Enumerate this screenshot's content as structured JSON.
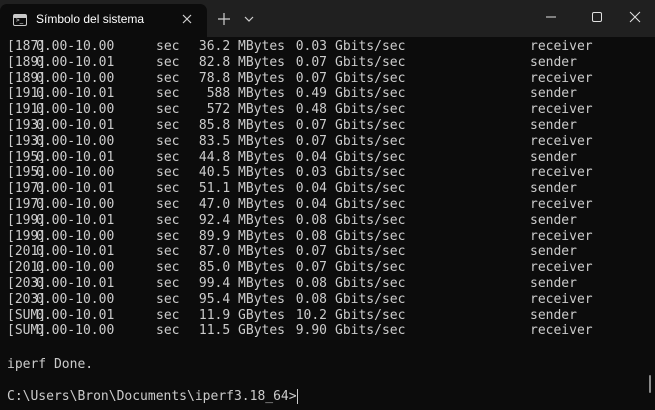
{
  "window": {
    "tab_title": "Símbolo del sistema",
    "icons": {
      "app": "cmd-icon",
      "tab_close": "close-icon",
      "new_tab": "plus-icon",
      "dropdown": "chevron-down-icon",
      "minimize": "minimize-icon",
      "maximize": "maximize-icon",
      "close": "close-icon"
    }
  },
  "terminal": {
    "rows": [
      {
        "id": "[187]",
        "interval": "0.00-10.00",
        "unit": "sec",
        "transfer": "36.2 MBytes",
        "rate": "0.03",
        "rate_unit": "Gbits/sec",
        "role": "receiver"
      },
      {
        "id": "[189]",
        "interval": "0.00-10.01",
        "unit": "sec",
        "transfer": "82.8 MBytes",
        "rate": "0.07",
        "rate_unit": "Gbits/sec",
        "role": "sender"
      },
      {
        "id": "[189]",
        "interval": "0.00-10.00",
        "unit": "sec",
        "transfer": "78.8 MBytes",
        "rate": "0.07",
        "rate_unit": "Gbits/sec",
        "role": "receiver"
      },
      {
        "id": "[191]",
        "interval": "0.00-10.01",
        "unit": "sec",
        "transfer": "588 MBytes",
        "rate": "0.49",
        "rate_unit": "Gbits/sec",
        "role": "sender"
      },
      {
        "id": "[191]",
        "interval": "0.00-10.00",
        "unit": "sec",
        "transfer": "572 MBytes",
        "rate": "0.48",
        "rate_unit": "Gbits/sec",
        "role": "receiver"
      },
      {
        "id": "[193]",
        "interval": "0.00-10.01",
        "unit": "sec",
        "transfer": "85.8 MBytes",
        "rate": "0.07",
        "rate_unit": "Gbits/sec",
        "role": "sender"
      },
      {
        "id": "[193]",
        "interval": "0.00-10.00",
        "unit": "sec",
        "transfer": "83.5 MBytes",
        "rate": "0.07",
        "rate_unit": "Gbits/sec",
        "role": "receiver"
      },
      {
        "id": "[195]",
        "interval": "0.00-10.01",
        "unit": "sec",
        "transfer": "44.8 MBytes",
        "rate": "0.04",
        "rate_unit": "Gbits/sec",
        "role": "sender"
      },
      {
        "id": "[195]",
        "interval": "0.00-10.00",
        "unit": "sec",
        "transfer": "40.5 MBytes",
        "rate": "0.03",
        "rate_unit": "Gbits/sec",
        "role": "receiver"
      },
      {
        "id": "[197]",
        "interval": "0.00-10.01",
        "unit": "sec",
        "transfer": "51.1 MBytes",
        "rate": "0.04",
        "rate_unit": "Gbits/sec",
        "role": "sender"
      },
      {
        "id": "[197]",
        "interval": "0.00-10.00",
        "unit": "sec",
        "transfer": "47.0 MBytes",
        "rate": "0.04",
        "rate_unit": "Gbits/sec",
        "role": "receiver"
      },
      {
        "id": "[199]",
        "interval": "0.00-10.01",
        "unit": "sec",
        "transfer": "92.4 MBytes",
        "rate": "0.08",
        "rate_unit": "Gbits/sec",
        "role": "sender"
      },
      {
        "id": "[199]",
        "interval": "0.00-10.00",
        "unit": "sec",
        "transfer": "89.9 MBytes",
        "rate": "0.08",
        "rate_unit": "Gbits/sec",
        "role": "receiver"
      },
      {
        "id": "[201]",
        "interval": "0.00-10.01",
        "unit": "sec",
        "transfer": "87.0 MBytes",
        "rate": "0.07",
        "rate_unit": "Gbits/sec",
        "role": "sender"
      },
      {
        "id": "[201]",
        "interval": "0.00-10.00",
        "unit": "sec",
        "transfer": "85.0 MBytes",
        "rate": "0.07",
        "rate_unit": "Gbits/sec",
        "role": "receiver"
      },
      {
        "id": "[203]",
        "interval": "0.00-10.01",
        "unit": "sec",
        "transfer": "99.4 MBytes",
        "rate": "0.08",
        "rate_unit": "Gbits/sec",
        "role": "sender"
      },
      {
        "id": "[203]",
        "interval": "0.00-10.00",
        "unit": "sec",
        "transfer": "95.4 MBytes",
        "rate": "0.08",
        "rate_unit": "Gbits/sec",
        "role": "receiver"
      },
      {
        "id": "[SUM]",
        "interval": "0.00-10.01",
        "unit": "sec",
        "transfer": "11.9 GBytes",
        "rate": "10.2",
        "rate_unit": "Gbits/sec",
        "role": "sender"
      },
      {
        "id": "[SUM]",
        "interval": "0.00-10.00",
        "unit": "sec",
        "transfer": "11.5 GBytes",
        "rate": "9.90",
        "rate_unit": "Gbits/sec",
        "role": "receiver"
      }
    ],
    "done_message": "iperf Done.",
    "prompt": "C:\\Users\\Bron\\Documents\\iperf3.18_64>"
  }
}
